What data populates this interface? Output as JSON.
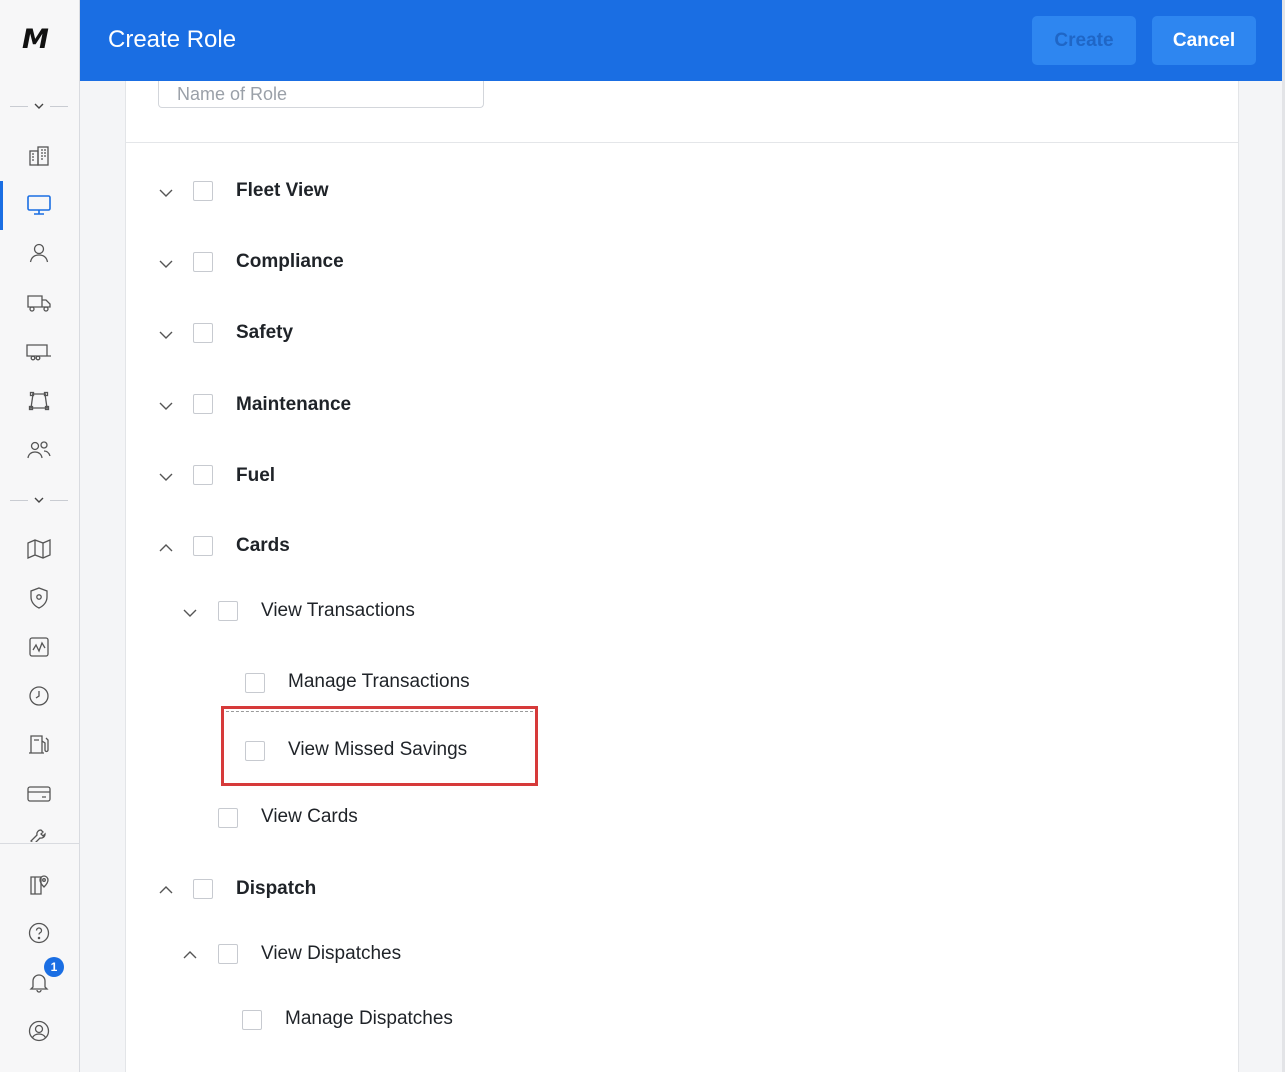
{
  "header": {
    "title": "Create Role",
    "create_label": "Create",
    "cancel_label": "Cancel"
  },
  "form": {
    "name_placeholder": "Name of Role"
  },
  "sidebar": {
    "logo": "M",
    "notification_count": "1",
    "icons": [
      "buildings-icon",
      "monitor-icon",
      "user-icon",
      "truck-icon",
      "trailer-icon",
      "route-icon",
      "users-icon",
      "map-icon",
      "shield-icon",
      "chart-icon",
      "clock-icon",
      "fuel-pump-icon",
      "card-icon",
      "tool-icon",
      "map-pin-book-icon",
      "help-icon",
      "bell-icon",
      "account-icon"
    ]
  },
  "permissions": {
    "fleet_view": "Fleet View",
    "compliance": "Compliance",
    "safety": "Safety",
    "maintenance": "Maintenance",
    "fuel": "Fuel",
    "cards": "Cards",
    "view_transactions": "View Transactions",
    "manage_transactions": "Manage Transactions",
    "view_missed_savings": "View Missed Savings",
    "view_cards": "View Cards",
    "dispatch": "Dispatch",
    "view_dispatches": "View Dispatches",
    "manage_dispatches": "Manage Dispatches"
  },
  "colors": {
    "accent": "#1a6ee3",
    "highlight": "#d63a3a"
  }
}
